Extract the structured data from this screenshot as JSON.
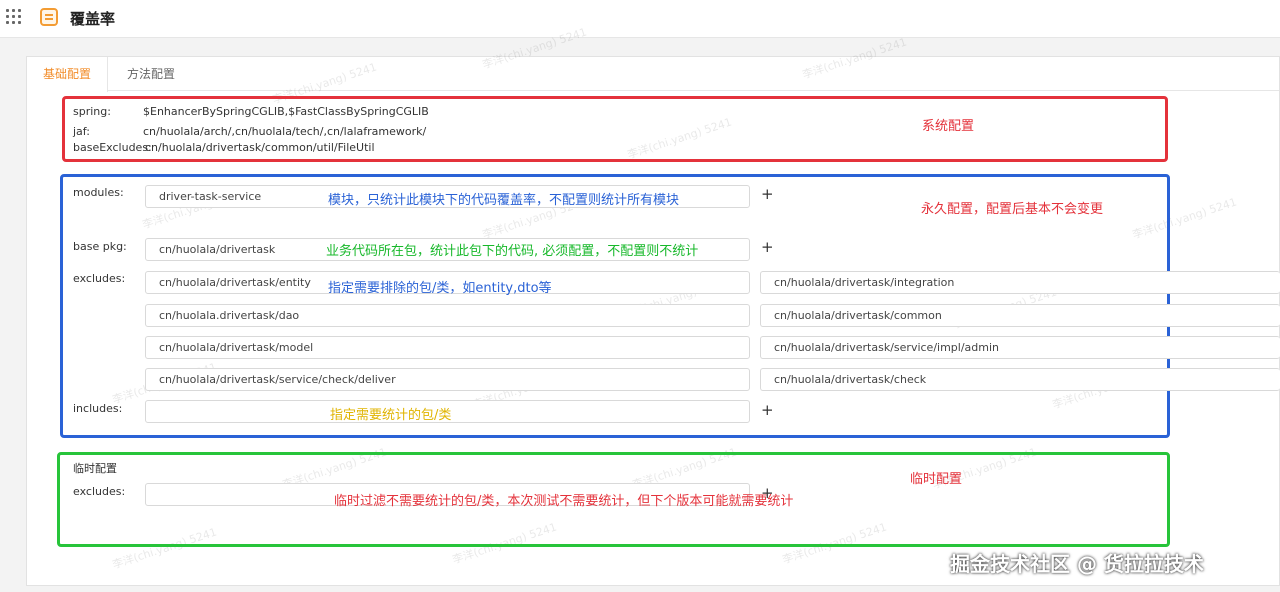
{
  "header": {
    "title": "覆盖率"
  },
  "tabs": [
    {
      "label": "基础配置",
      "active": true
    },
    {
      "label": "方法配置",
      "active": false
    }
  ],
  "system": {
    "spring_label": "spring:",
    "spring_value": "$EnhancerBySpringCGLIB,$FastClassBySpringCGLIB",
    "jaf_label": "jaf:",
    "jaf_value": "cn/huolala/arch/,cn/huolala/tech/,cn/lalaframework/",
    "base_excludes_label": "baseExcludes:",
    "base_excludes_value": "cn/huolala/drivertask/common/util/FileUtil"
  },
  "permanent": {
    "modules_label": "modules:",
    "modules_value": "driver-task-service",
    "base_pkg_label": "base pkg:",
    "base_pkg_value": "cn/huolala/drivertask",
    "excludes_label": "excludes:",
    "excludes_left": [
      "cn/huolala/drivertask/entity",
      "cn/huolala.drivertask/dao",
      "cn/huolala/drivertask/model",
      "cn/huolala/drivertask/service/check/deliver"
    ],
    "excludes_right": [
      "cn/huolala/drivertask/integration",
      "cn/huolala/drivertask/common",
      "cn/huolala/drivertask/service/impl/admin",
      "cn/huolala/drivertask/check"
    ],
    "includes_label": "includes:",
    "includes_value": ""
  },
  "temporary": {
    "section_label": "临时配置",
    "excludes_label": "excludes:",
    "excludes_value": ""
  },
  "annotations": {
    "system": "系统配置",
    "modules": "模块，只统计此模块下的代码覆盖率，不配置则统计所有模块",
    "permanent": "永久配置，配置后基本不会变更",
    "base_pkg": "业务代码所在包，统计此包下的代码, 必须配置，不配置则不统计",
    "excludes": "指定需要排除的包/类，如entity,dto等",
    "includes": "指定需要统计的包/类",
    "temporary": "临时配置",
    "temp_excludes": "临时过滤不需要统计的包/类，本次测试不需要统计，但下个版本可能就需要统计"
  },
  "plus_symbol": "+",
  "watermark": "李洋(chi.yang) 5241",
  "footer_watermark": "掘金技术社区 @ 货拉拉技术",
  "colors": {
    "accent": "#f28c28",
    "red": "#e4323b",
    "blue": "#2a62d6",
    "green": "#27c43a",
    "yellow": "#e0b400"
  }
}
